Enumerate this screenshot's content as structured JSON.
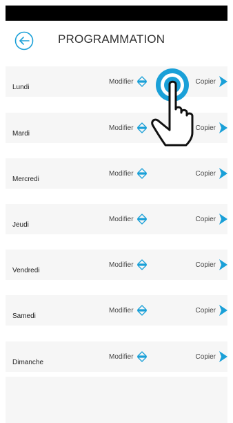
{
  "header": {
    "title": "PROGRAMMATION"
  },
  "colors": {
    "accent": "#1aa0d8",
    "row_background": "#f6f6f6",
    "status_bar": "#000000"
  },
  "days": [
    {
      "name": "Lundi",
      "modify_label": "Modifier",
      "copy_label": "Copier"
    },
    {
      "name": "Mardi",
      "modify_label": "Modifier",
      "copy_label": "Copier"
    },
    {
      "name": "Mercredi",
      "modify_label": "Modifier",
      "copy_label": "Copier"
    },
    {
      "name": "Jeudi",
      "modify_label": "Modifier",
      "copy_label": "Copier"
    },
    {
      "name": "Vendredi",
      "modify_label": "Modifier",
      "copy_label": "Copier"
    },
    {
      "name": "Samedi",
      "modify_label": "Modifier",
      "copy_label": "Copier"
    },
    {
      "name": "Dimanche",
      "modify_label": "Modifier",
      "copy_label": "Copier"
    }
  ],
  "icons": {
    "back": "back-arrow-circle-icon",
    "modify": "up-down-arrow-icon",
    "copy": "copy-arrow-icon",
    "tap_hint": "tap-hand-pointer-icon"
  }
}
